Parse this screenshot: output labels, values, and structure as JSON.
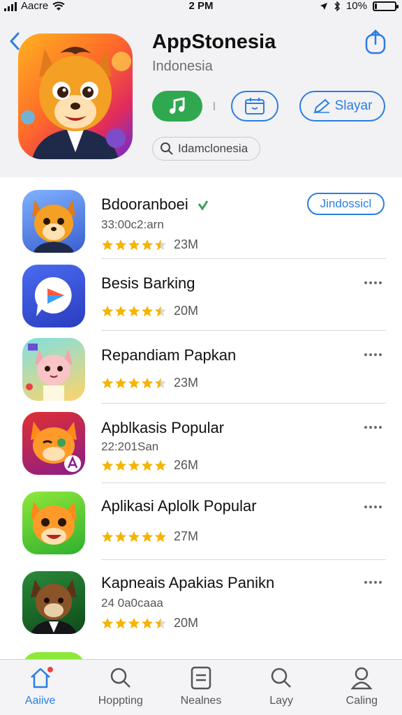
{
  "status_bar": {
    "carrier": "Aacre",
    "time": "2 PM",
    "battery": "10%",
    "battery_level": 0.1
  },
  "header": {
    "title": "AppStonesia",
    "subtitle": "Indonesia",
    "actions": {
      "music_icon": "music-note-icon",
      "calendar_icon": "calendar-icon",
      "slayar_label": "Slayar"
    },
    "search_chip": "Idamclonesia"
  },
  "apps": [
    {
      "name": "Bdooranboei",
      "meta": "33:00c2:arn",
      "rating": 4.5,
      "count": "23M",
      "action": "Jindossicl",
      "verified": true
    },
    {
      "name": "Besis Barking",
      "meta": "",
      "rating": 4.5,
      "count": "20M"
    },
    {
      "name": "Repandiam Papkan",
      "meta": "",
      "rating": 4.5,
      "count": "23M"
    },
    {
      "name": "Apblkasis Popular",
      "meta": "22:201San",
      "rating": 5,
      "count": "26M"
    },
    {
      "name": "Aplikasi  Aplolk Popular",
      "meta": "",
      "rating": 5,
      "count": "27M"
    },
    {
      "name": "Kapneais Apakias Panikn",
      "meta": "24 0а0сааа",
      "rating": 4.5,
      "count": "20M"
    }
  ],
  "tabs": [
    {
      "label": "Aaiive",
      "icon": "home-icon",
      "active": true
    },
    {
      "label": "Hoppting",
      "icon": "search-icon"
    },
    {
      "label": "Nealnes",
      "icon": "list-icon"
    },
    {
      "label": "Layy",
      "icon": "search-icon"
    },
    {
      "label": "Caling",
      "icon": "profile-icon"
    }
  ],
  "colors": {
    "accent": "#2a7de1",
    "green": "#2fa84f",
    "star": "#f5b400"
  }
}
